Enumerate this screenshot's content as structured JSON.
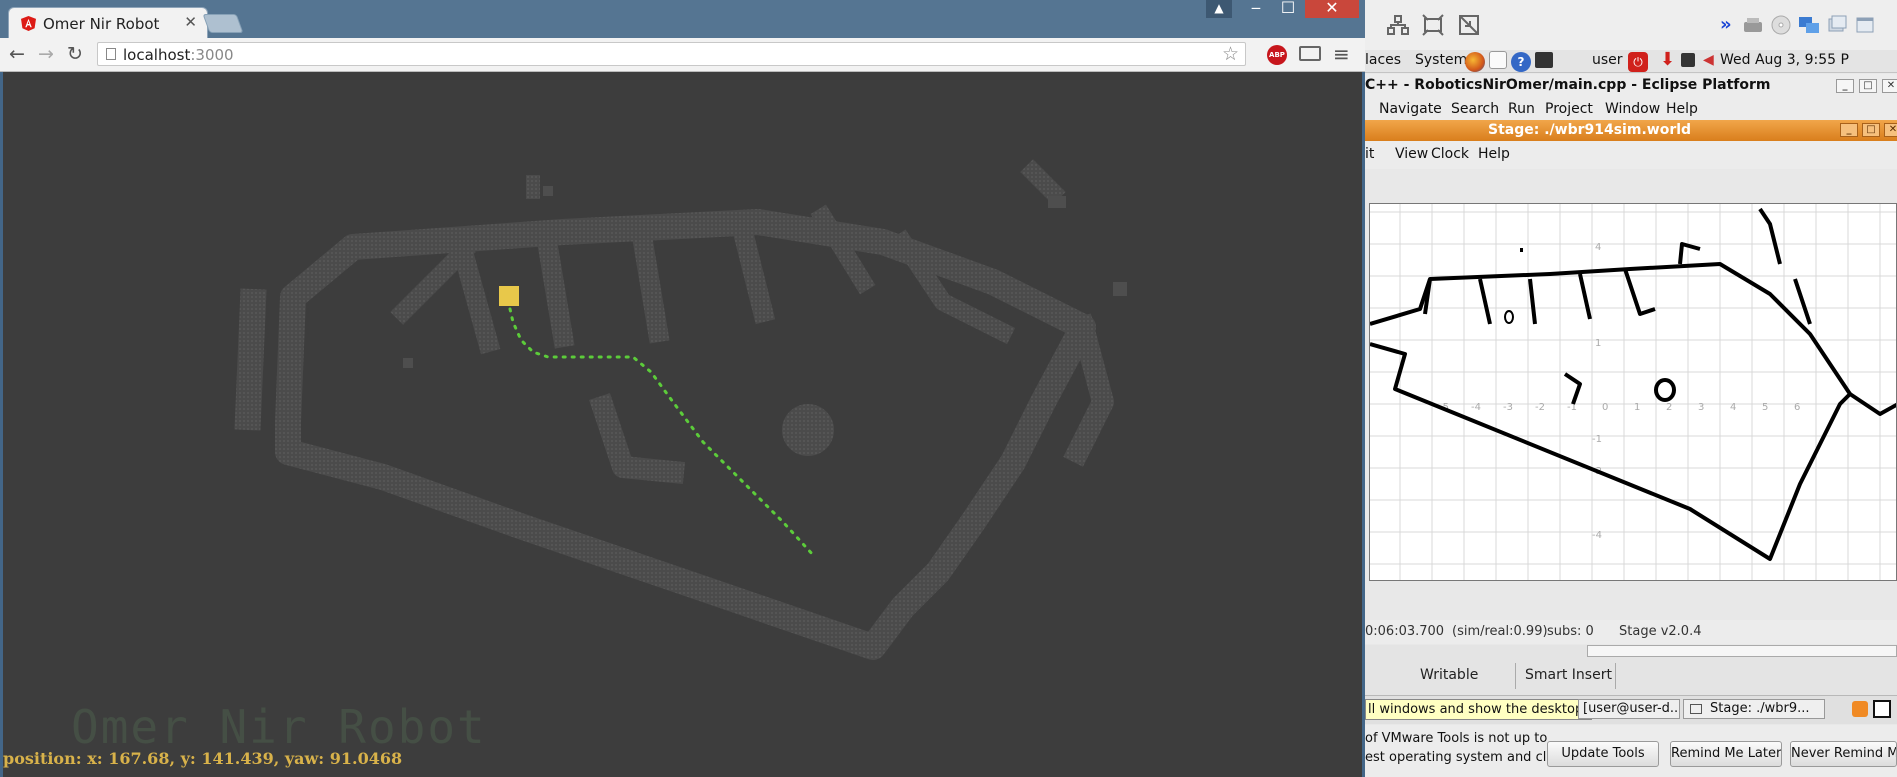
{
  "browser": {
    "tab_title": "Omer Nir Robot",
    "tab_close": "✕",
    "url_host": "localhost",
    "url_port": ":3000",
    "abp_label": "ABP"
  },
  "robot_app": {
    "watermark": "Omer Nir Robot",
    "position_text": "position: x: 167.68, y: 141.439, yaw: 91.0468"
  },
  "desktop": {
    "panel": {
      "places": "laces",
      "system": "System",
      "user": "user",
      "clock": "Wed Aug  3,  9:55 P"
    },
    "eclipse": {
      "title": "C++ - RoboticsNirOmer/main.cpp - Eclipse Platform",
      "menu": [
        "Navigate",
        "Search",
        "Run",
        "Project",
        "Window",
        "Help"
      ],
      "status_writable": "Writable",
      "status_insert": "Smart Insert"
    },
    "stage": {
      "title": "Stage: ./wbr914sim.world",
      "menu": [
        "it",
        "View",
        "Clock",
        "Help"
      ],
      "time": "0:06:03.700",
      "sim_real": "(sim/real:0.99)",
      "subs": "subs: 0",
      "version": "Stage v2.0.4",
      "x_ticks": [
        "-5",
        "-4",
        "-3",
        "-2",
        "-1",
        "0",
        "1",
        "2",
        "3",
        "4",
        "5",
        "6"
      ],
      "y_ticks": [
        "4",
        "1",
        "-1",
        "-2",
        "-4"
      ]
    },
    "taskbar": {
      "tooltip": "ll windows and show the desktop.",
      "task1": "[user@user-d...",
      "task2": "Stage: ./wbr9..."
    },
    "vmware": {
      "line1": "of VMware Tools is not up to",
      "line2": "est operating system and click",
      "update": "Update Tools",
      "remind_later": "Remind Me Later",
      "never_remind": "Never Remind Me"
    }
  }
}
